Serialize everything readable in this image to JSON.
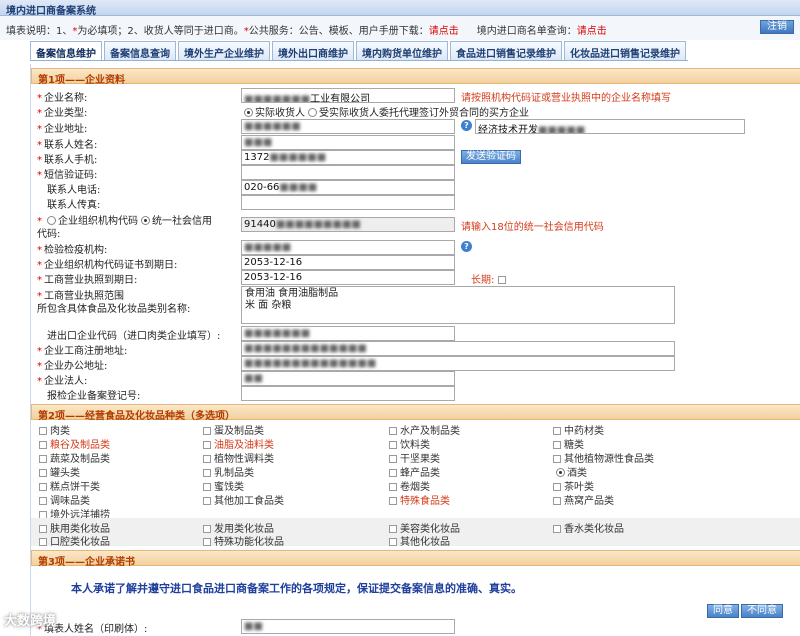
{
  "window": {
    "title": "境内进口商备案系统"
  },
  "notice": {
    "prefix": "填表说明：1、",
    "star": "*",
    "req_text": "为必填项；2、收货人等同于进口商。",
    "star2": "*",
    "service_text": "公共服务：公告、模板、用户手册下载：",
    "link1": "请点击",
    "query_text": "境内进口商名单查询：",
    "link2": "请点击",
    "logout": "注销"
  },
  "tabs": [
    {
      "label": "备案信息维护"
    },
    {
      "label": "备案信息查询"
    },
    {
      "label": "境外生产企业维护"
    },
    {
      "label": "境外出口商维护"
    },
    {
      "label": "境内购货单位维护"
    },
    {
      "label": "食品进口销售记录维护"
    },
    {
      "label": "化妆品进口销售记录维护"
    }
  ],
  "section1": {
    "title": "第1项——企业资料",
    "company_name_label": "企业名称:",
    "company_name_value": "工业有限公司",
    "company_name_hint": "请按照机构代码证或营业执照中的企业名称填写",
    "company_type_label": "企业类型:",
    "company_type_opt1": "实际收货人",
    "company_type_opt2": "受实际收货人委托代理签订外贸合同的买方企业",
    "address_label": "企业地址:",
    "address_value2": "经济技术开发",
    "contact_name_label": "联系人姓名:",
    "contact_mobile_label": "联系人手机:",
    "contact_mobile_value": "1372",
    "sms_button": "发送验证码",
    "sms_code_label": "短信验证码:",
    "contact_phone_label": "联系人电话:",
    "contact_phone_value": "020-66",
    "contact_fax_label": "联系人传真:",
    "code_type_opt1": "企业组织机构代码",
    "code_type_opt2": "统一社会信用",
    "code_type_suffix": "代码:",
    "code_value": "91440",
    "code_hint": "请输入18位的统一社会信用代码",
    "inspection_label": "检验检疫机构:",
    "org_code_expiry_label": "企业组织机构代码证书到期日:",
    "org_code_expiry_value": "2053-12-16",
    "license_expiry_label": "工商营业执照到期日:",
    "license_expiry_value": "2053-12-16",
    "long_term_label": "长期:",
    "scope_label": "工商营业执照范围",
    "scope_label2": "所包含具体食品及化妆品类别名称:",
    "scope_line1": "食用油 食用油脂制品",
    "scope_line2": "米 面 杂粮",
    "import_code_label": "进出口企业代码（进口肉类企业填写）:",
    "reg_address_label": "企业工商注册地址:",
    "office_address_label": "企业办公地址:",
    "legal_rep_label": "企业法人:",
    "inspection_reg_label": "报检企业备案登记号:"
  },
  "section2": {
    "title": "第2项——经营食品及化妆品种类（多选项）",
    "categories": [
      {
        "label": "肉类"
      },
      {
        "label": "蛋及制品类"
      },
      {
        "label": "水产及制品类"
      },
      {
        "label": "中药材类"
      },
      {
        "label": "粮谷及制品类"
      },
      {
        "label": "油脂及油料类"
      },
      {
        "label": "饮料类"
      },
      {
        "label": "糖类"
      },
      {
        "label": "蔬菜及制品类"
      },
      {
        "label": "植物性调料类"
      },
      {
        "label": "干坚果类"
      },
      {
        "label": "其他植物源性食品类"
      },
      {
        "label": "罐头类"
      },
      {
        "label": "乳制品类"
      },
      {
        "label": "蜂产品类"
      },
      {
        "label": "酒类"
      },
      {
        "label": "糕点饼干类"
      },
      {
        "label": "蜜饯类"
      },
      {
        "label": "卷烟类"
      },
      {
        "label": "茶叶类"
      },
      {
        "label": "调味品类"
      },
      {
        "label": "其他加工食品类"
      },
      {
        "label": "特殊食品类"
      },
      {
        "label": "燕窝产品类"
      },
      {
        "label": "境外远洋捕捞"
      }
    ],
    "cosmetics": [
      {
        "label": "肤用类化妆品"
      },
      {
        "label": "发用类化妆品"
      },
      {
        "label": "美容类化妆品"
      },
      {
        "label": "香水类化妆品"
      },
      {
        "label": "口腔类化妆品"
      },
      {
        "label": "特殊功能化妆品"
      },
      {
        "label": "其他化妆品"
      }
    ]
  },
  "section3": {
    "title": "第3项——企业承诺书",
    "pledge": "本人承诺了解并遵守进口食品进口商备案工作的各项规定，保证提交备案信息的准确、真实。",
    "agree": "同意",
    "disagree": "不同意",
    "rep_name_label": "填表人姓名（印刷体）:"
  },
  "watermark": "大数跨境",
  "colors": {
    "accent": "#3e7fcf",
    "warn": "#d43a1a",
    "section": "#b23c00"
  }
}
